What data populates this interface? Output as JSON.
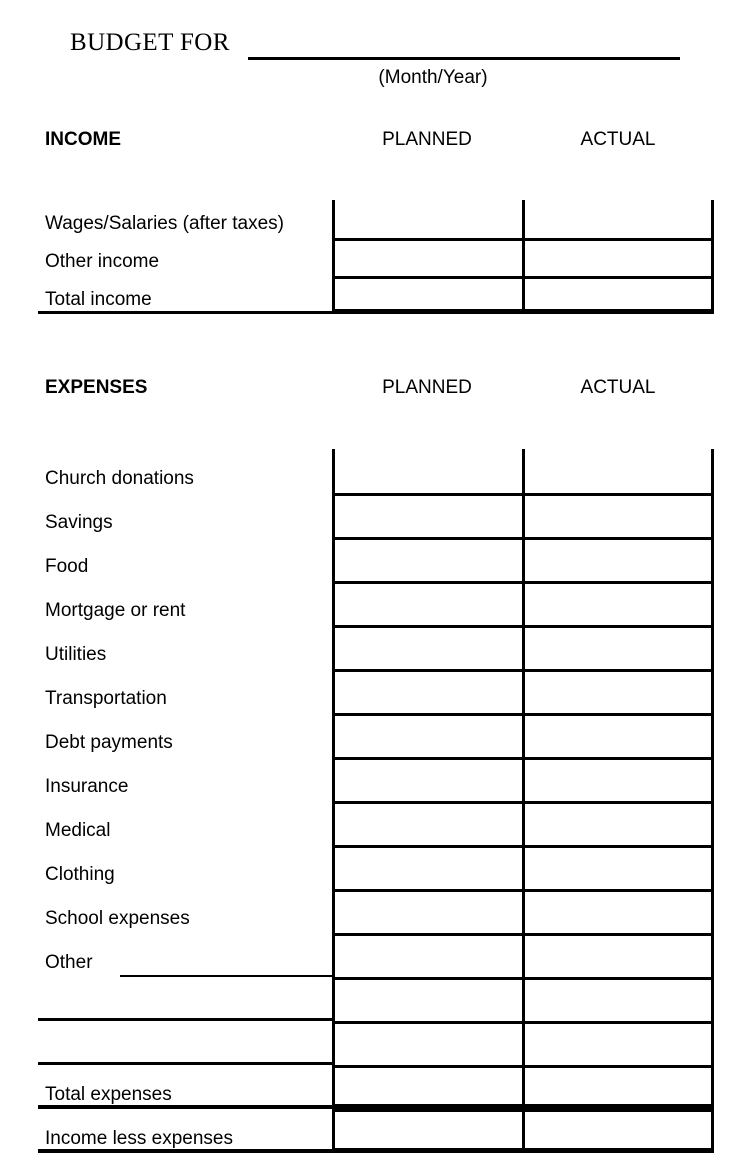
{
  "title": {
    "text": "BUDGET FOR",
    "blank_line": true,
    "sub_label": "(Month/Year)"
  },
  "income_section": {
    "heading": "INCOME",
    "columns": [
      "PLANNED",
      "ACTUAL"
    ],
    "rows": [
      {
        "label": "Wages/Salaries (after taxes)",
        "planned": "",
        "actual": "",
        "underline": false
      },
      {
        "label": "Other income",
        "planned": "",
        "actual": "",
        "underline": false
      },
      {
        "label": "Total income",
        "planned": "",
        "actual": "",
        "underline": true
      }
    ]
  },
  "expenses_section": {
    "heading": "EXPENSES",
    "columns": [
      "PLANNED",
      "ACTUAL"
    ],
    "rows": [
      {
        "label": "Church donations",
        "planned": "",
        "actual": "",
        "underline": false
      },
      {
        "label": "Savings",
        "planned": "",
        "actual": "",
        "underline": false
      },
      {
        "label": "Food",
        "planned": "",
        "actual": "",
        "underline": false
      },
      {
        "label": "Mortgage or rent",
        "planned": "",
        "actual": "",
        "underline": false
      },
      {
        "label": "Utilities",
        "planned": "",
        "actual": "",
        "underline": false
      },
      {
        "label": "Transportation",
        "planned": "",
        "actual": "",
        "underline": false
      },
      {
        "label": "Debt payments",
        "planned": "",
        "actual": "",
        "underline": false
      },
      {
        "label": "Insurance",
        "planned": "",
        "actual": "",
        "underline": false
      },
      {
        "label": "Medical",
        "planned": "",
        "actual": "",
        "underline": false
      },
      {
        "label": "Clothing",
        "planned": "",
        "actual": "",
        "underline": false
      },
      {
        "label": "School expenses",
        "planned": "",
        "actual": "",
        "underline": false
      },
      {
        "label": "Other",
        "planned": "",
        "actual": "",
        "underline": "writein"
      },
      {
        "label": "",
        "planned": "",
        "actual": "",
        "underline": true
      },
      {
        "label": "",
        "planned": "",
        "actual": "",
        "underline": true
      },
      {
        "label": "Total expenses",
        "planned": "",
        "actual": "",
        "underline": "thick"
      },
      {
        "label": "Income less expenses",
        "planned": "",
        "actual": "",
        "underline": "thick"
      }
    ]
  },
  "colors": {
    "ink": "#000000",
    "paper": "#ffffff"
  }
}
